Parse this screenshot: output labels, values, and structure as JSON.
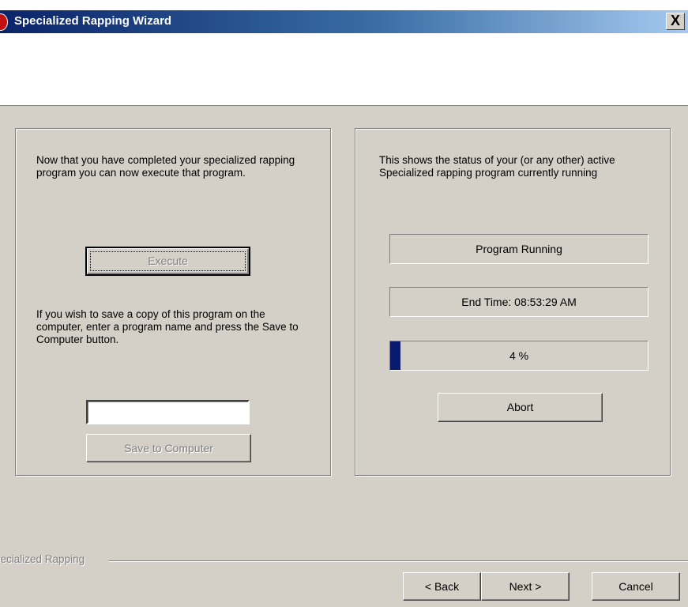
{
  "window": {
    "title": "Specialized Rapping Wizard",
    "close_label": "X"
  },
  "left_panel": {
    "intro_text": "Now that you have completed your specialized rapping program you can now execute that program.",
    "execute_label": "Execute",
    "save_instructions": "If you wish to save a copy of this program on the computer, enter a program name and press the Save to Computer button.",
    "program_name_value": "",
    "save_label": "Save to Computer"
  },
  "right_panel": {
    "status_intro": "This shows the status of your (or any other) active Specialized rapping program currently running",
    "status_text": "Program Running",
    "end_time_text": "End Time: 08:53:29 AM",
    "progress_percent": 4,
    "progress_text": "4 %",
    "abort_label": "Abort"
  },
  "footer": {
    "group_label": "Specialized Rapping",
    "back_label": "< Back",
    "next_label": "Next >",
    "cancel_label": "Cancel"
  },
  "colors": {
    "titlebar_start": "#0a246a",
    "dialog_face": "#d4d0c8",
    "progress_fill": "#0a1a6e"
  }
}
